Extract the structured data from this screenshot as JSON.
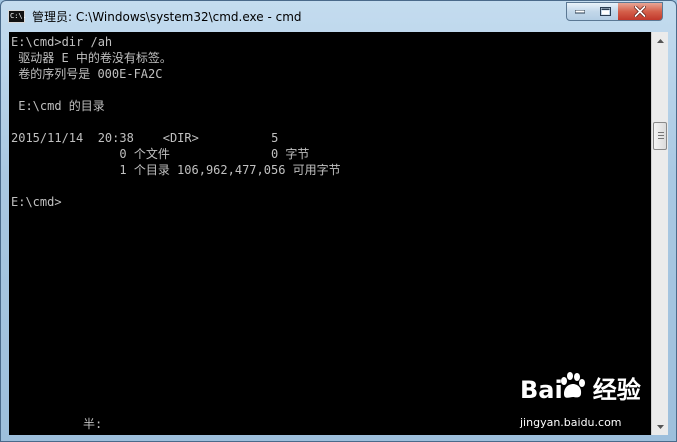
{
  "window": {
    "title": "管理员: C:\\Windows\\system32\\cmd.exe - cmd",
    "icon_text": "C:\\."
  },
  "controls": {
    "minimize_icon": "minimize-icon",
    "maximize_icon": "maximize-icon",
    "close_icon": "close-icon"
  },
  "console": {
    "background": "#000000",
    "foreground": "#c0c0c0",
    "lines": [
      "E:\\cmd>dir /ah",
      " 驱动器 E 中的卷没有标签。",
      " 卷的序列号是 000E-FA2C",
      "",
      " E:\\cmd 的目录",
      "",
      "2015/11/14  20:38    <DIR>          5",
      "               0 个文件              0 字节",
      "               1 个目录 106,962,477,056 可用字节",
      "",
      "E:\\cmd>"
    ],
    "ime_status": "半:"
  },
  "watermark": {
    "brand_left": "Bai",
    "brand_right": "经验",
    "url": "jingyan.baidu.com"
  }
}
